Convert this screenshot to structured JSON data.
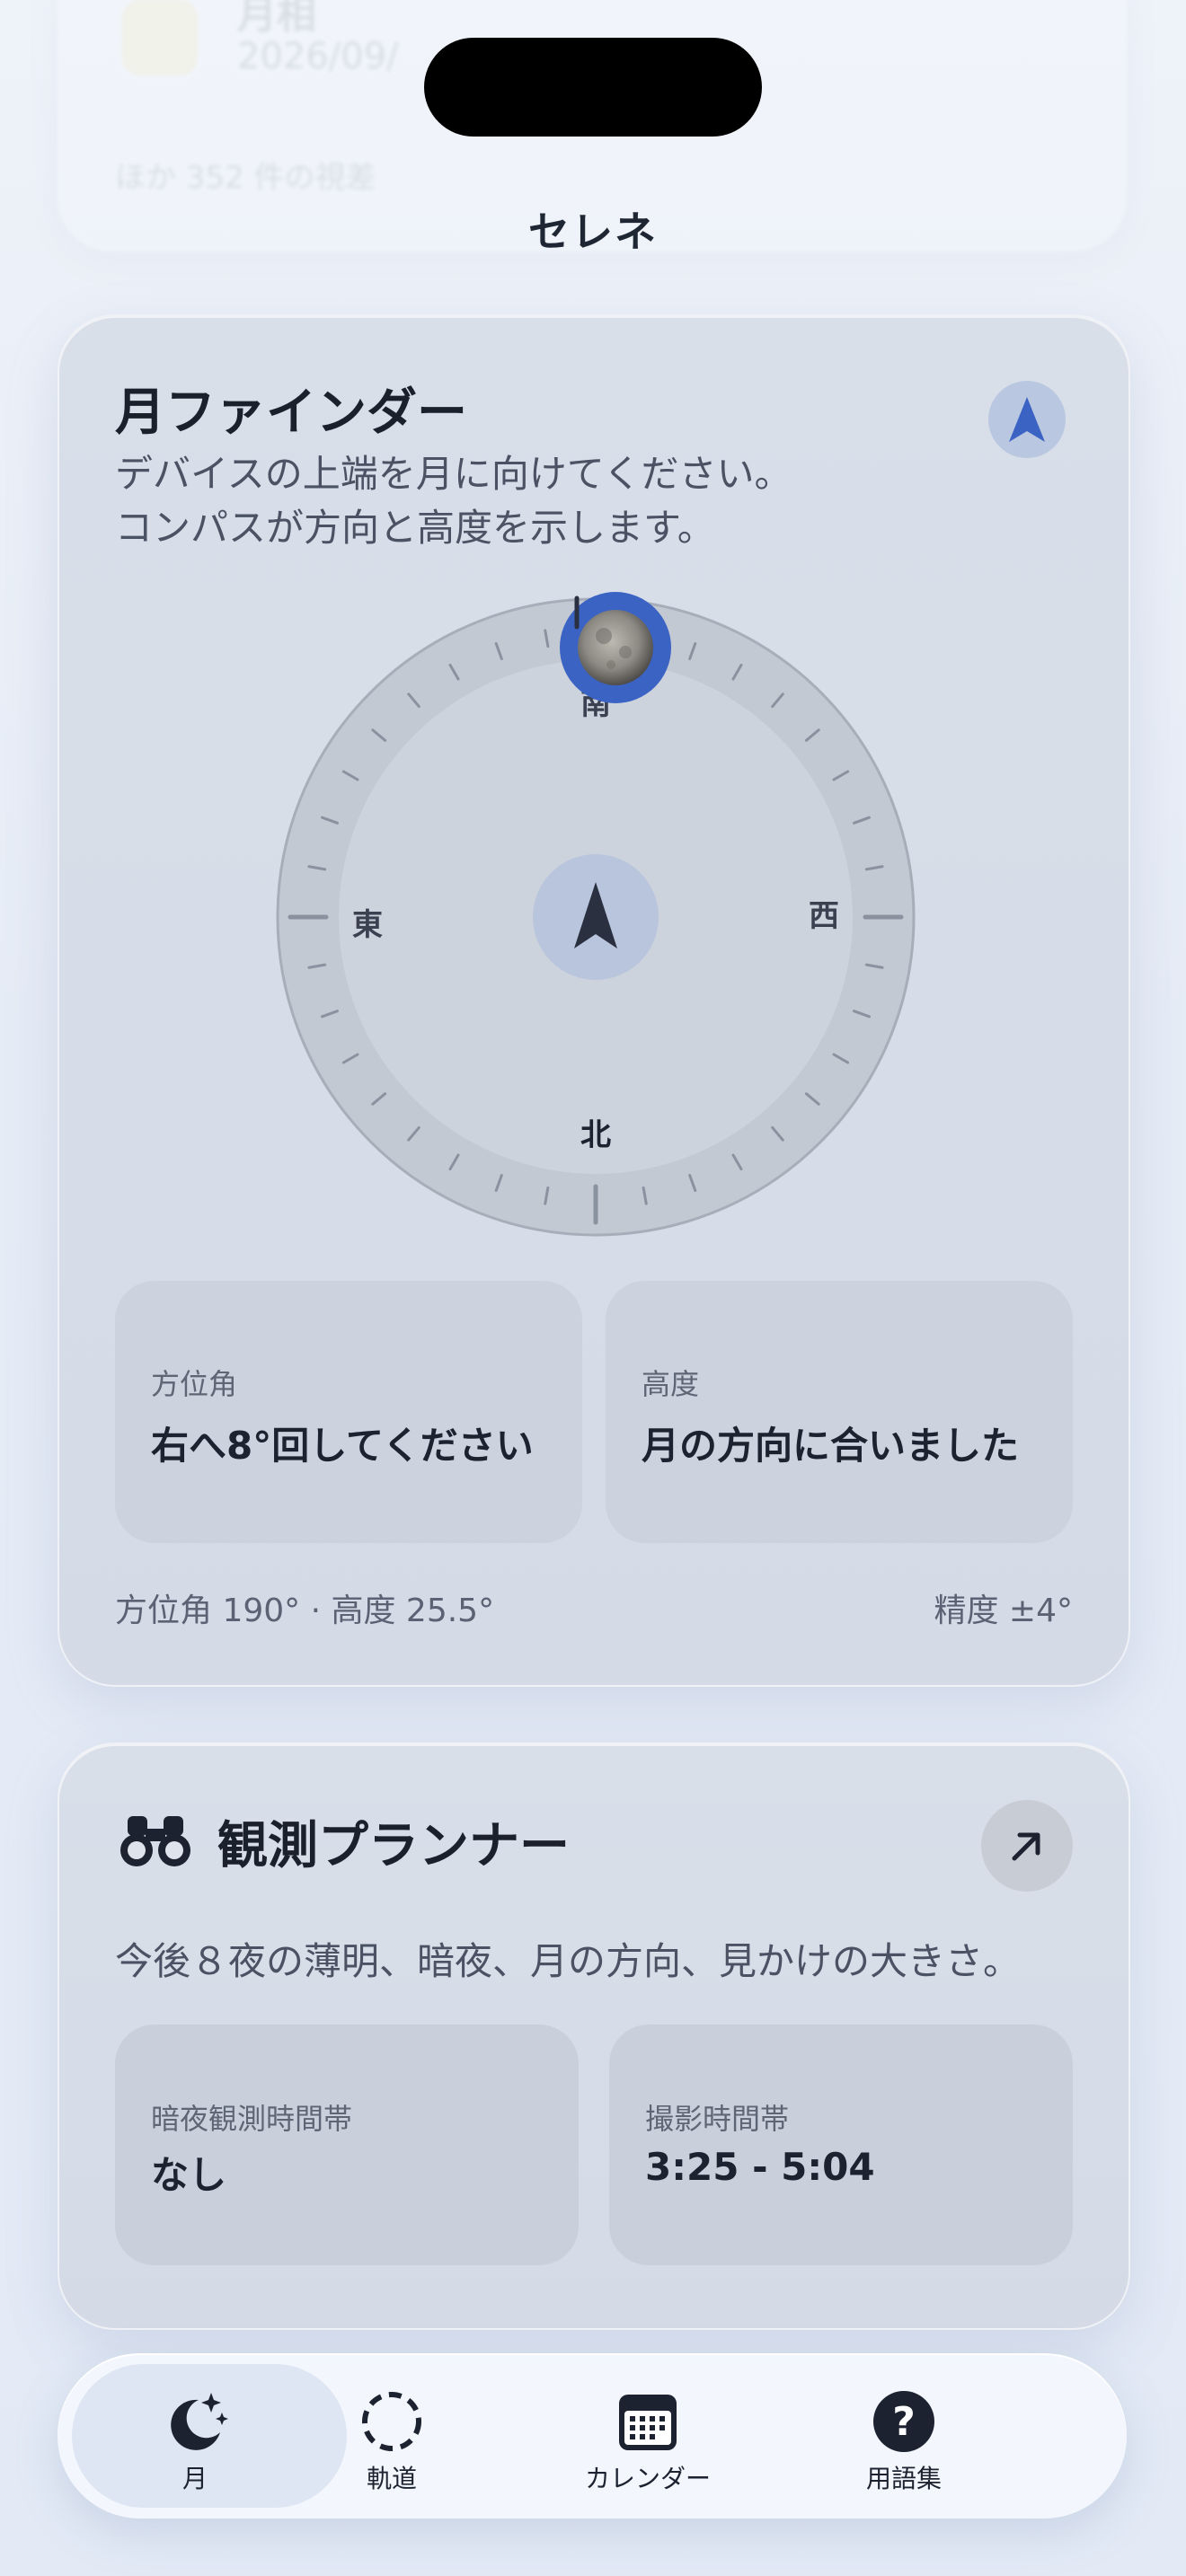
{
  "header": {
    "app_title": "セレネ"
  },
  "background_card": {
    "title": "月相",
    "subtitle": "2026/09/",
    "note": "ほか 352 件の視差"
  },
  "moon_finder": {
    "title": "月ファインダー",
    "description_line1": "デバイスの上端を月に向けてください。",
    "description_line2": "コンパスが方向と高度を示します。",
    "compass": {
      "south": "南",
      "east": "東",
      "west": "西",
      "north": "北",
      "moon_azimuth_deg": 190
    },
    "azimuth_box": {
      "label": "方位角",
      "value": "右へ8°回してください"
    },
    "altitude_box": {
      "label": "高度",
      "value": "月の方向に合いました"
    },
    "footer_reading": "方位角 190° · 高度 25.5°",
    "footer_accuracy": "精度 ±4°",
    "accent_color": "#3b63c4"
  },
  "planner": {
    "title": "観測プランナー",
    "description": "今後８夜の薄明、暗夜、月の方向、見かけの大きさ。",
    "dark_window": {
      "label": "暗夜観測時間帯",
      "value": "なし"
    },
    "photo_window": {
      "label": "撮影時間帯",
      "value": "3:25 - 5:04"
    }
  },
  "tabbar": {
    "tabs": [
      {
        "label": "月",
        "icon": "moon-stars-icon",
        "active": true
      },
      {
        "label": "軌道",
        "icon": "dashed-circle-icon",
        "active": false
      },
      {
        "label": "カレンダー",
        "icon": "calendar-icon",
        "active": false
      },
      {
        "label": "用語集",
        "icon": "question-icon",
        "active": false
      }
    ]
  }
}
